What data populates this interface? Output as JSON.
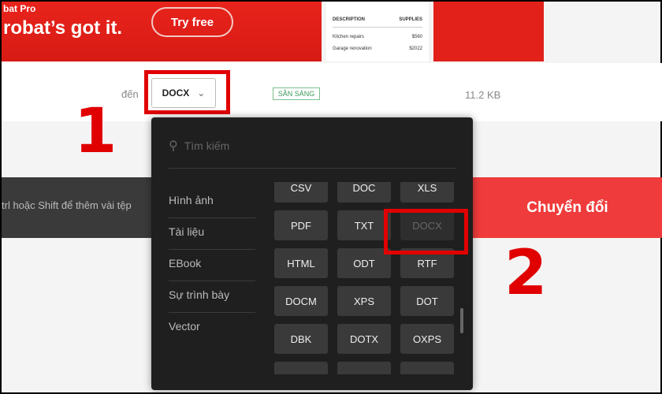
{
  "banner": {
    "brand": "bat Pro",
    "headline": "robat’s got it.",
    "cta": "Try free",
    "doc": {
      "headers": [
        "DESCRIPTION",
        "SUPPLIES"
      ],
      "rows": [
        [
          "Kitchen repairs",
          "$560"
        ],
        [
          "Garage renovation",
          "$2022"
        ]
      ]
    }
  },
  "file_row": {
    "to_label": "đến",
    "selected_format": "DOCX",
    "status": "SẴN SÀNG",
    "size": "11.2 KB"
  },
  "drop_hint": "trl hoặc Shift để thêm vài tệp",
  "convert_button": "Chuyển đổi",
  "annotations": [
    "1",
    "2"
  ],
  "dropdown": {
    "search_placeholder": "Tìm kiếm",
    "categories": [
      "Hình ảnh",
      "Tài liệu",
      "EBook",
      "Sự trình bày",
      "Vector"
    ],
    "formats": [
      "CSV",
      "DOC",
      "XLS",
      "PDF",
      "TXT",
      "DOCX",
      "HTML",
      "ODT",
      "RTF",
      "DOCM",
      "XPS",
      "DOT",
      "DBK",
      "DOTX",
      "OXPS",
      "",
      "",
      ""
    ],
    "current": "DOCX"
  },
  "colors": {
    "accent": "#e3211b",
    "highlight": "#e10000",
    "panel": "#1f1f1f"
  }
}
